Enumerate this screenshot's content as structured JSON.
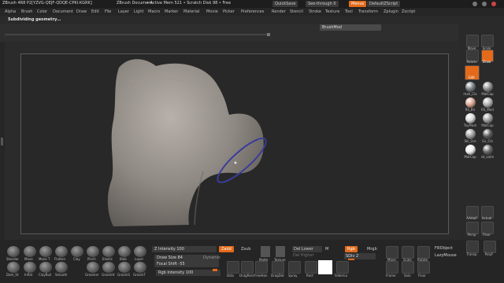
{
  "titlebar": {
    "app": "ZBrush 4R8 P2[YZVG-QEJF-QDQE-CPKI-KGRK]",
    "document": "ZBrush Document",
    "active": "• Active Mem 521 • Scratch Disk 98 • Free",
    "quicksave": "QuickSave",
    "seethrough": "See-through",
    "seethrough_value": "0",
    "menus": "Menus",
    "script": "DefaultZScript"
  },
  "menubar": {
    "items": [
      "Alpha",
      "Brush",
      "Color",
      "Document",
      "Draw",
      "Edit",
      "File",
      "Layer",
      "Light",
      "Macro",
      "Marker",
      "Material",
      "Movie",
      "Picker",
      "Preferences",
      "Render",
      "Stencil",
      "Stroke",
      "Texture",
      "Tool",
      "Transform",
      "Zplugin",
      "Zscript"
    ]
  },
  "status": {
    "message": "Subdividing geometry...",
    "brush_label": "BrushMod"
  },
  "right_shelf": {
    "buttons": [
      "Move",
      "Scale",
      "Rotate",
      "Draw",
      "Edit"
    ],
    "materials": [
      {
        "name": "mah_Clo",
        "color": "#7a7f86"
      },
      {
        "name": "MatCap",
        "color": "#8c8c8c"
      },
      {
        "name": "RS_Bir",
        "color": "#d9a592"
      },
      {
        "name": "RS_Mod",
        "color": "#b0b0b0"
      },
      {
        "name": "ToyPlast",
        "color": "#d8d8d8"
      },
      {
        "name": "MatCap",
        "color": "#9c9c9c"
      },
      {
        "name": "Ski_Gre",
        "color": "#a0a0a0"
      },
      {
        "name": "Gv_Clo",
        "color": "#5a5a5a"
      },
      {
        "name": "MatCap",
        "color": "#eeeeee"
      },
      {
        "name": "sd_satin",
        "color": "#666666"
      }
    ],
    "lower": [
      "AAHalf",
      "Actual",
      "Persp",
      "Floor",
      "Local",
      "Frame",
      "Move",
      "Scale",
      "Rotate",
      "Transp",
      "Solo",
      "Xpose",
      "PolyF"
    ]
  },
  "bottom": {
    "brushes": [
      "Standar",
      "Move",
      "Move T",
      "Flatten",
      "Clay",
      "Pinch",
      "Elastic",
      "Blob",
      "Layer",
      "Dam_St",
      "Inflat",
      "ClayBuil",
      "Smooth",
      "Groomer",
      "GroomH",
      "GroomS",
      "GroomT"
    ],
    "zintensity_label": "Z Intensity",
    "zintensity": "100",
    "zadd": "Zadd",
    "zsub": "Zsub",
    "draw_size_label": "Draw Size",
    "draw_size": "84",
    "dynamic": "Dynamic",
    "focal_shift_label": "Focal Shift",
    "focal_shift": "-55",
    "rgb_intensity_label": "Rgb Intensity",
    "rgb_intensity": "100",
    "mrgb": "Mrgb",
    "rgb": "Rgb",
    "m": "M",
    "del_lower": "Del Lower",
    "del_higher": "Del Higher",
    "sdiv_label": "SDiv",
    "sdiv": "2",
    "fill_object": "FillObject",
    "lazy_mouse": "LazyMouse",
    "tools": [
      "Dots",
      "DragRect",
      "FreeHan",
      "DragDot",
      "Spray",
      "Rect",
      "",
      "SliderLo"
    ],
    "swatches": [
      "Matte",
      "Texture"
    ]
  }
}
